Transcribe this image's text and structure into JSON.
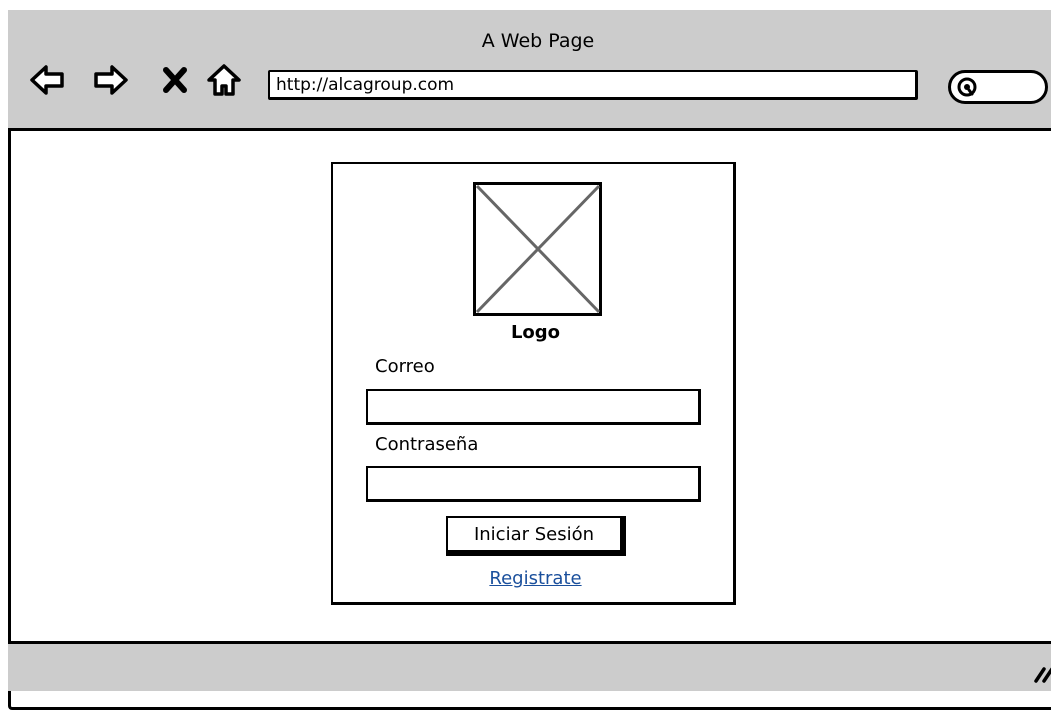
{
  "window": {
    "title": "A Web Page"
  },
  "toolbar": {
    "back_icon": "back-arrow-icon",
    "forward_icon": "forward-arrow-icon",
    "stop_icon": "close-icon",
    "home_icon": "home-icon",
    "address": "http://alcagroup.com",
    "search_icon": "search-icon"
  },
  "login": {
    "logo_caption": "Logo",
    "email_label": "Correo",
    "email_value": "",
    "password_label": "Contraseña",
    "password_value": "",
    "submit_label": "Iniciar Sesión",
    "register_link": "Registrate",
    "link_color": "#1a4f9c"
  },
  "colors": {
    "chrome": "#cccccc",
    "ink": "#000000",
    "page": "#ffffff",
    "placeholder_cross": "#666666"
  }
}
